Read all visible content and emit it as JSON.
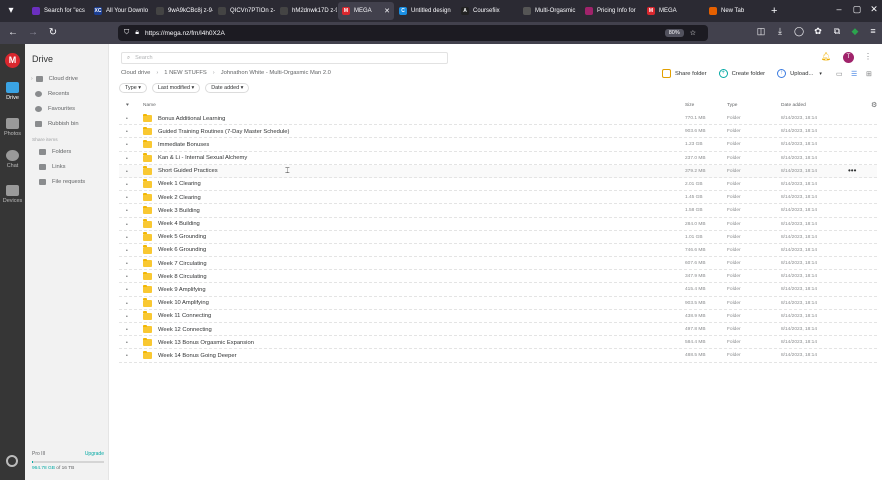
{
  "browser": {
    "tabs": [
      {
        "label": "Search for \"ecs",
        "favicon_color": "#6b2fbf",
        "favicon_text": ""
      },
      {
        "label": "All Your Downlo",
        "favicon_color": "#1c3f94",
        "favicon_text": "XC"
      },
      {
        "label": "9wA9kCBc8j z-9-y",
        "favicon_color": "#444444",
        "favicon_text": ""
      },
      {
        "label": "QICVn7PTIOn z-9-y",
        "favicon_color": "#444444",
        "favicon_text": ""
      },
      {
        "label": "hM2dnwk17D z-9-y",
        "favicon_color": "#444444",
        "favicon_text": ""
      },
      {
        "label": "MEGA",
        "favicon_color": "#d9272e",
        "favicon_text": "M",
        "active": true
      },
      {
        "label": "Untitled design",
        "favicon_color": "#1a8fe3",
        "favicon_text": "C"
      },
      {
        "label": "Coursefiix",
        "favicon_color": "#222222",
        "favicon_text": "A"
      },
      {
        "label": "Multi-Orgasmic",
        "favicon_color": "#555555",
        "favicon_text": ""
      },
      {
        "label": "Pricing Info for",
        "favicon_color": "#a0236b",
        "favicon_text": ""
      },
      {
        "label": "MEGA",
        "favicon_color": "#d9272e",
        "favicon_text": "M"
      },
      {
        "label": "New Tab",
        "favicon_color": "#e66000",
        "favicon_text": ""
      }
    ],
    "url": "https://mega.nz/fm/l4h0X2A",
    "zoom": "80%"
  },
  "rail": {
    "items": [
      {
        "label": "Drive"
      },
      {
        "label": "Photos"
      },
      {
        "label": "Chat"
      },
      {
        "label": "Devices"
      }
    ]
  },
  "sidebar": {
    "title": "Drive",
    "items": [
      {
        "label": "Cloud drive"
      },
      {
        "label": "Recents"
      },
      {
        "label": "Favourites"
      },
      {
        "label": "Rubbish bin"
      }
    ],
    "shares_heading": "Share items",
    "share_items": [
      {
        "label": "Folders"
      },
      {
        "label": "Links"
      },
      {
        "label": "File requests"
      }
    ],
    "storage": {
      "plan": "Pro III",
      "upgrade": "Upgrade",
      "used_fraction": 0.02,
      "used_value": "964.78 GB",
      "used_total": "of 16 TB"
    }
  },
  "search": {
    "placeholder": "Search"
  },
  "breadcrumb": [
    "Cloud drive",
    "1 NEW STUFFS",
    "Johnathon White - Multi-Orgasmic Man 2.0"
  ],
  "actions": {
    "share": "Share folder",
    "create": "Create folder",
    "upload": "Upload..."
  },
  "filters": [
    "Type",
    "Last modified",
    "Date added"
  ],
  "table": {
    "headers": {
      "name": "Name",
      "size": "Size",
      "type": "Type",
      "date": "Date added"
    },
    "rows": [
      {
        "name": "Bonus Additional Learning",
        "size": "770.1 MB",
        "type": "Folder",
        "date": "8/14/2023, 18:14"
      },
      {
        "name": "Guided Training Routines (7-Day Master Schedule)",
        "size": "903.6 MB",
        "type": "Folder",
        "date": "8/14/2023, 18:14"
      },
      {
        "name": "Immediate Bonuses",
        "size": "1.23 GB",
        "type": "Folder",
        "date": "8/14/2023, 18:14"
      },
      {
        "name": "Kan & Li - Internal Sexual Alchemy",
        "size": "237.0 MB",
        "type": "Folder",
        "date": "8/14/2023, 18:14"
      },
      {
        "name": "Short Guided Practices",
        "size": "379.2 MB",
        "type": "Folder",
        "date": "8/14/2023, 18:14"
      },
      {
        "name": "Week 1 Clearing",
        "size": "2.01 GB",
        "type": "Folder",
        "date": "8/14/2023, 18:14"
      },
      {
        "name": "Week 2 Clearing",
        "size": "1.45 GB",
        "type": "Folder",
        "date": "8/14/2023, 18:14"
      },
      {
        "name": "Week 3 Building",
        "size": "1.58 GB",
        "type": "Folder",
        "date": "8/14/2023, 18:14"
      },
      {
        "name": "Week 4 Building",
        "size": "284.0 MB",
        "type": "Folder",
        "date": "8/14/2023, 18:14"
      },
      {
        "name": "Week 5 Grounding",
        "size": "1.01 GB",
        "type": "Folder",
        "date": "8/14/2023, 18:14"
      },
      {
        "name": "Week 6 Grounding",
        "size": "746.6 MB",
        "type": "Folder",
        "date": "8/14/2023, 18:14"
      },
      {
        "name": "Week 7 Circulating",
        "size": "607.6 MB",
        "type": "Folder",
        "date": "8/14/2023, 18:14"
      },
      {
        "name": "Week 8 Circulating",
        "size": "347.9 MB",
        "type": "Folder",
        "date": "8/14/2023, 18:14"
      },
      {
        "name": "Week 9 Amplifying",
        "size": "415.4 MB",
        "type": "Folder",
        "date": "8/14/2023, 18:14"
      },
      {
        "name": "Week 10 Amplifying",
        "size": "903.5 MB",
        "type": "Folder",
        "date": "8/14/2023, 18:14"
      },
      {
        "name": "Week 11 Connecting",
        "size": "438.9 MB",
        "type": "Folder",
        "date": "8/14/2023, 18:14"
      },
      {
        "name": "Week 12 Connecting",
        "size": "497.8 MB",
        "type": "Folder",
        "date": "8/14/2023, 18:14"
      },
      {
        "name": "Week 13 Bonus Orgasmic Expansion",
        "size": "584.4 MB",
        "type": "Folder",
        "date": "8/14/2023, 18:14"
      },
      {
        "name": "Week 14 Bonus Going Deeper",
        "size": "488.5 MB",
        "type": "Folder",
        "date": "8/14/2023, 18:14"
      }
    ]
  },
  "colors": {
    "accent": "#04a9a4",
    "folder": "#f9c832",
    "brand": "#d9272e"
  }
}
